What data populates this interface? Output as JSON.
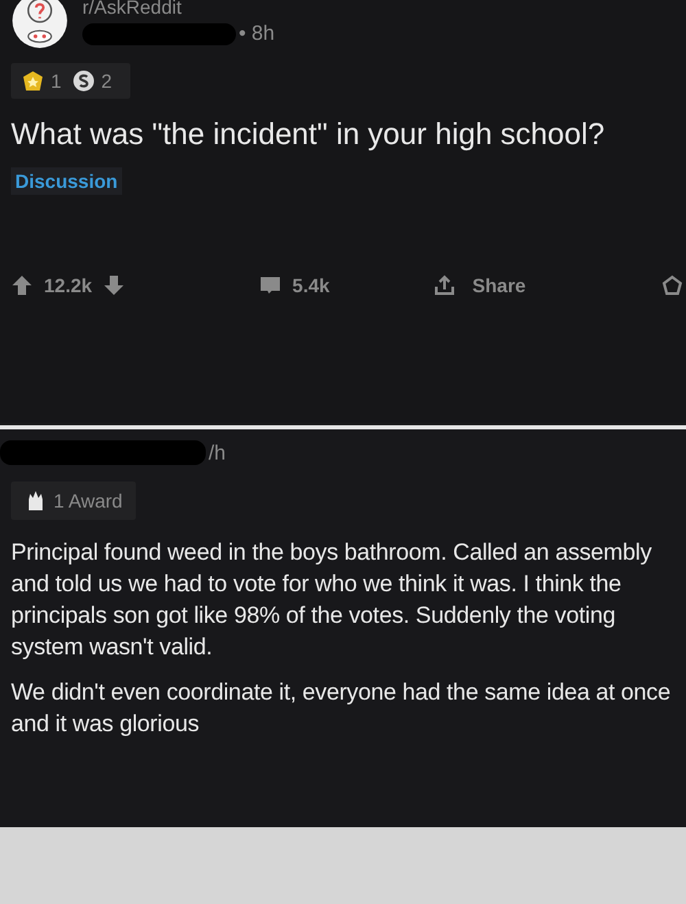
{
  "post": {
    "subreddit": "r/AskReddit",
    "time": "• 8h",
    "awards": [
      {
        "kind": "gold",
        "count": "1"
      },
      {
        "kind": "silver",
        "count": "2"
      }
    ],
    "title": "What was \"the incident\" in your high school?",
    "flair": "Discussion",
    "votes": "12.2k",
    "comments": "5.4k",
    "share": "Share"
  },
  "comment": {
    "time": "/h",
    "award": "1 Award",
    "paragraphs": [
      "Principal found weed in the boys bathroom. Called an assembly and told us we had to vote for who we think it was. I think the principals son got like 98% of the votes. Suddenly the voting system wasn't valid.",
      "We didn't even coordinate it, everyone had the same idea at once and it was glorious"
    ]
  }
}
